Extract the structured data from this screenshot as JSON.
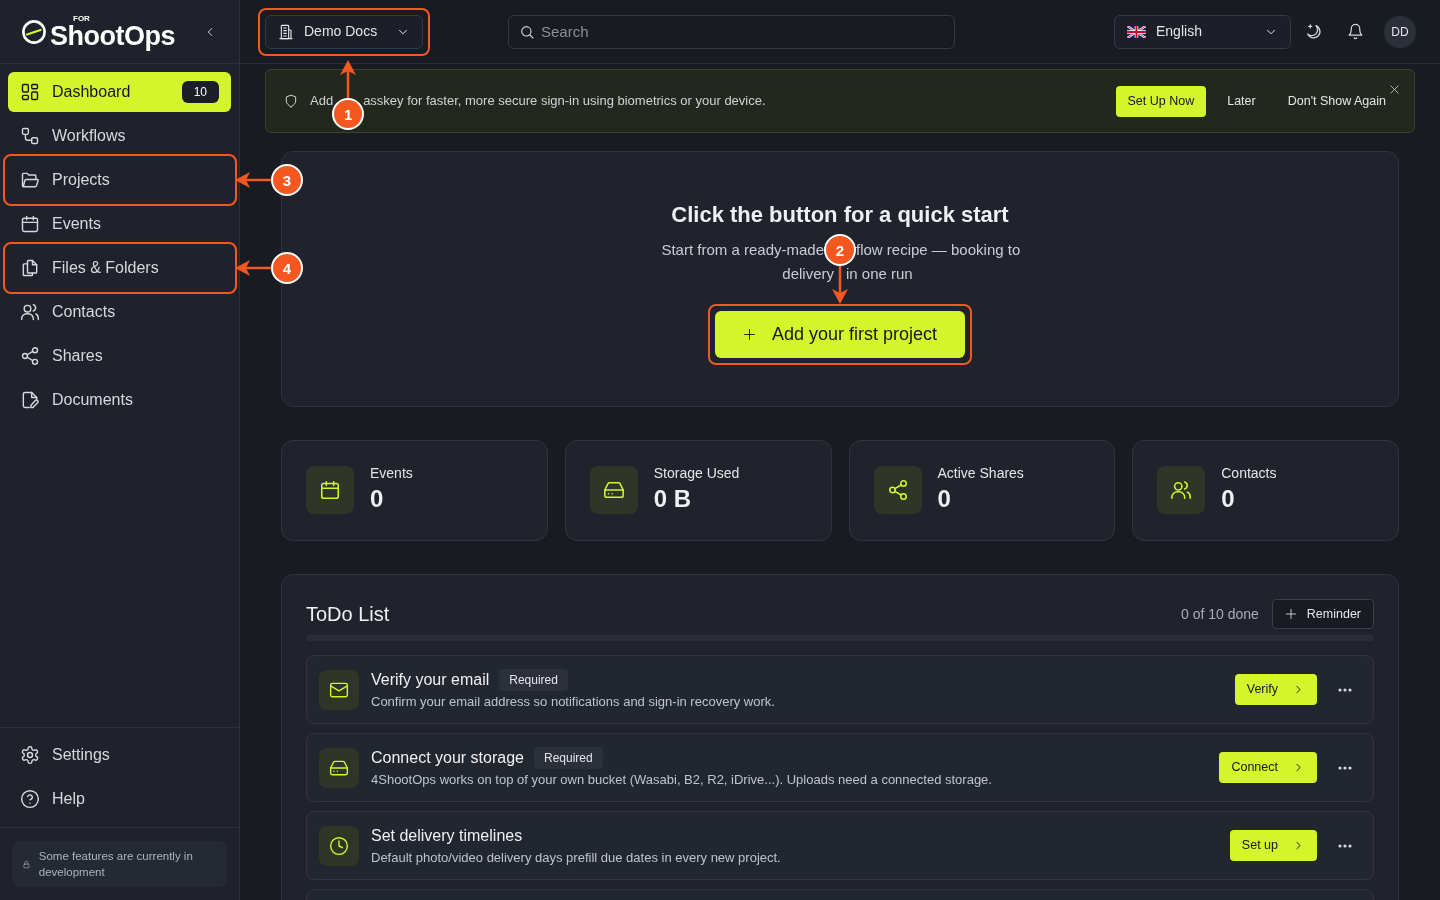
{
  "sidebar": {
    "logo": {
      "tag": "FOR",
      "wordmark": "ShootOps"
    },
    "items": [
      {
        "label": "Dashboard",
        "selected": true,
        "badge": "10"
      },
      {
        "label": "Workflows",
        "selected": false
      },
      {
        "label": "Projects",
        "selected": false,
        "callout": "3"
      },
      {
        "label": "Events",
        "selected": false
      },
      {
        "label": "Files & Folders",
        "selected": false,
        "callout": "4"
      },
      {
        "label": "Contacts",
        "selected": false
      },
      {
        "label": "Shares",
        "selected": false
      },
      {
        "label": "Documents",
        "selected": false
      }
    ],
    "footer_items": [
      {
        "label": "Settings"
      },
      {
        "label": "Help"
      }
    ],
    "note": "Some features are currently in development"
  },
  "topbar": {
    "workspace": {
      "label": "Demo Docs",
      "callout": "1"
    },
    "search": {
      "placeholder": "Search"
    },
    "language": {
      "label": "English"
    },
    "avatar": "DD"
  },
  "banner": {
    "message_parts": [
      "Add",
      "asskey for faster, more secure sign-in using biometrics or your device."
    ],
    "buttons": [
      {
        "label": "Set Up Now",
        "kind": "primary"
      },
      {
        "label": "Later",
        "kind": "plain"
      },
      {
        "label": "Don't Show Again",
        "kind": "plain"
      }
    ]
  },
  "hero": {
    "title": "Click the button for a quick start",
    "subtitle_lines": [
      [
        "Start from a ready-made",
        "flow recipe — booking to"
      ],
      [
        "delivery",
        "in one run"
      ]
    ],
    "button": {
      "label": "Add your first project",
      "callout": "2"
    }
  },
  "stats": [
    {
      "label": "Events",
      "value": "0"
    },
    {
      "label": "Storage Used",
      "value": "0 B"
    },
    {
      "label": "Active Shares",
      "value": "0"
    },
    {
      "label": "Contacts",
      "value": "0"
    }
  ],
  "todo": {
    "title": "ToDo List",
    "summary": "0 of 10 done",
    "button": "Reminder",
    "progress": {
      "level": 0
    },
    "tasks": [
      {
        "title": "Verify your email",
        "badge": "Required",
        "description": "Confirm your email address so notifications and sign-in recovery work.",
        "action": "Verify"
      },
      {
        "title": "Connect your storage",
        "badge": "Required",
        "description": "4ShootOps works on top of your own bucket (Wasabi, B2, R2, iDrive...). Uploads need a connected storage.",
        "action": "Connect"
      },
      {
        "title": "Set delivery timelines",
        "description": "Default photo/video delivery days prefill due dates in every new project.",
        "action": "Set up"
      }
    ]
  }
}
